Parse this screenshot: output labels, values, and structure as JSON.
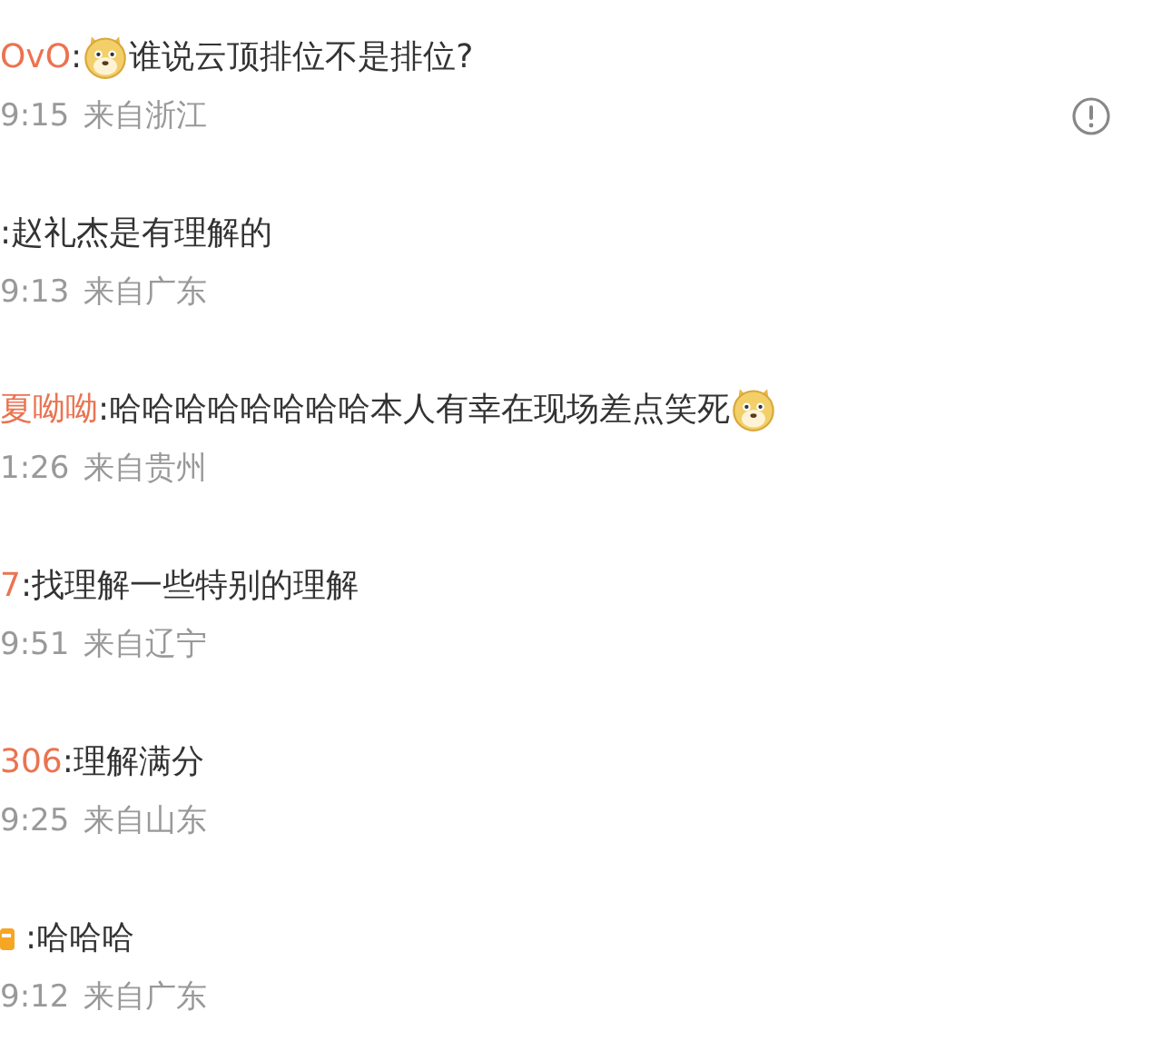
{
  "comments": [
    {
      "name": "OvO",
      "separator": ":",
      "leading_emoji": true,
      "text": "谁说云顶排位不是排位?",
      "trailing_emoji": false,
      "badge": false,
      "time": "9:15",
      "location": "来自浙江",
      "report": true
    },
    {
      "separator": ":",
      "text": "赵礼杰是有理解的",
      "leading_emoji": false,
      "trailing_emoji": false,
      "badge": false,
      "time": "9:13",
      "location": "来自广东",
      "report": false
    },
    {
      "name": "夏呦呦",
      "separator": ":",
      "leading_emoji": false,
      "text": "哈哈哈哈哈哈哈哈本人有幸在现场差点笑死",
      "trailing_emoji": true,
      "badge": false,
      "time": "1:26",
      "location": "来自贵州",
      "report": false
    },
    {
      "name": "7",
      "separator": ":",
      "leading_emoji": false,
      "text": "找理解一些特别的理解",
      "trailing_emoji": false,
      "badge": false,
      "time": "9:51",
      "location": "来自辽宁",
      "report": false
    },
    {
      "name": "306",
      "separator": ":",
      "leading_emoji": false,
      "text": "理解满分",
      "trailing_emoji": false,
      "badge": false,
      "time": "9:25",
      "location": "来自山东",
      "report": false
    },
    {
      "separator": ":",
      "leading_emoji": false,
      "text": "哈哈哈",
      "trailing_emoji": false,
      "badge": true,
      "time": "9:12",
      "location": "来自广东",
      "report": false
    }
  ]
}
